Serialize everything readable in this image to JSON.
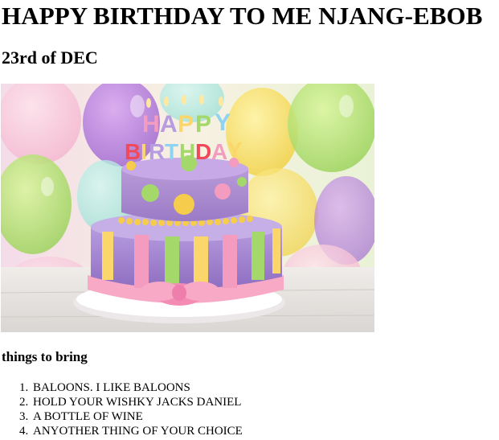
{
  "title": "HAPPY BIRTHDAY TO ME NJANG-EBOB",
  "date": "23rd of DEC",
  "image": {
    "alt": "birthday cake image",
    "candle_letters_top": "HAPPY",
    "candle_letters_bottom": "BIRTHDAY"
  },
  "list_heading": "things to bring",
  "items": [
    {
      "number": "1.",
      "text": "BALOONS. I LIKE BALOONS"
    },
    {
      "number": "2.",
      "text": "HOLD YOUR WISHKY JACKS DANIEL"
    },
    {
      "number": "3.",
      "text": "A BOTTLE OF WINE"
    },
    {
      "number": "4.",
      "text": "ANYOTHER THING OF YOUR CHOICE"
    }
  ]
}
